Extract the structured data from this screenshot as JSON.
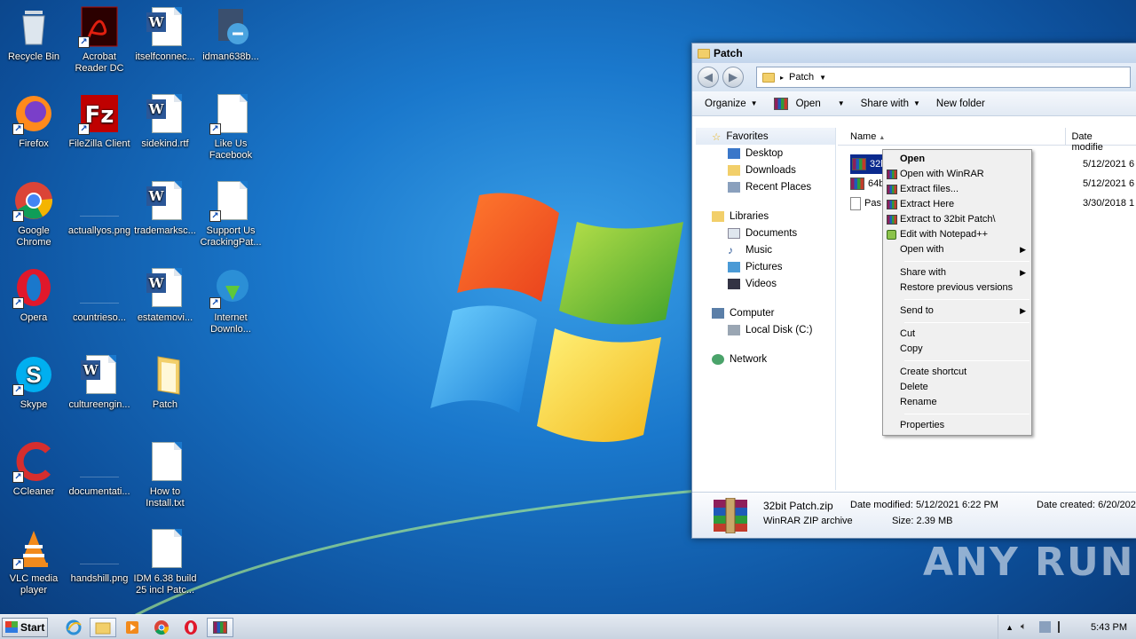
{
  "desktop": {
    "icons": [
      {
        "label": "Recycle Bin"
      },
      {
        "label": "Acrobat Reader DC"
      },
      {
        "label": "itselfconnec..."
      },
      {
        "label": "idman638b..."
      },
      {
        "label": "Firefox"
      },
      {
        "label": "FileZilla Client"
      },
      {
        "label": "sidekind.rtf"
      },
      {
        "label": "Like Us Facebook"
      },
      {
        "label": "Google Chrome"
      },
      {
        "label": "actuallyos.png"
      },
      {
        "label": "trademarksc..."
      },
      {
        "label": "Support Us CrackingPat..."
      },
      {
        "label": "Opera"
      },
      {
        "label": "countrieso..."
      },
      {
        "label": "estatemovi..."
      },
      {
        "label": "Internet Downlo..."
      },
      {
        "label": "Skype"
      },
      {
        "label": "cultureengin..."
      },
      {
        "label": "Patch"
      },
      {
        "label": "CCleaner"
      },
      {
        "label": "documentati..."
      },
      {
        "label": "How to Install.txt"
      },
      {
        "label": "VLC media player"
      },
      {
        "label": "handshill.png"
      },
      {
        "label": "IDM 6.38 build 25 incl Patc..."
      }
    ]
  },
  "explorer": {
    "title": "Patch",
    "address": "Patch",
    "toolbar": {
      "organize": "Organize",
      "open": "Open",
      "share": "Share with",
      "new_folder": "New folder"
    },
    "nav": {
      "favorites": "Favorites",
      "desktop": "Desktop",
      "downloads": "Downloads",
      "recent": "Recent Places",
      "libraries": "Libraries",
      "documents": "Documents",
      "music": "Music",
      "pictures": "Pictures",
      "videos": "Videos",
      "computer": "Computer",
      "local_disk": "Local Disk (C:)",
      "network": "Network"
    },
    "columns": {
      "name": "Name",
      "date": "Date modifie"
    },
    "files": [
      {
        "name": "32b",
        "date": "5/12/2021 6"
      },
      {
        "name": "64b",
        "date": "5/12/2021 6"
      },
      {
        "name": "Pas",
        "date": "3/30/2018 1"
      }
    ],
    "details": {
      "filename": "32bit Patch.zip",
      "type": "WinRAR ZIP archive",
      "modified": "Date modified: 5/12/2021 6:22 PM",
      "size": "Size: 2.39 MB",
      "created": "Date created: 6/20/202"
    }
  },
  "context_menu": {
    "open": "Open",
    "open_winrar": "Open with WinRAR",
    "extract_files": "Extract files...",
    "extract_here": "Extract Here",
    "extract_to": "Extract to 32bit Patch\\",
    "edit_notepad": "Edit with Notepad++",
    "open_with": "Open with",
    "share_with": "Share with",
    "restore": "Restore previous versions",
    "send_to": "Send to",
    "cut": "Cut",
    "copy": "Copy",
    "create_shortcut": "Create shortcut",
    "delete": "Delete",
    "rename": "Rename",
    "properties": "Properties"
  },
  "taskbar": {
    "start": "Start",
    "clock": "5:43 PM"
  },
  "watermark": "ANY RUN",
  "colors": {
    "selection": "#0b2a8e",
    "desktop": "#1a78cc"
  }
}
